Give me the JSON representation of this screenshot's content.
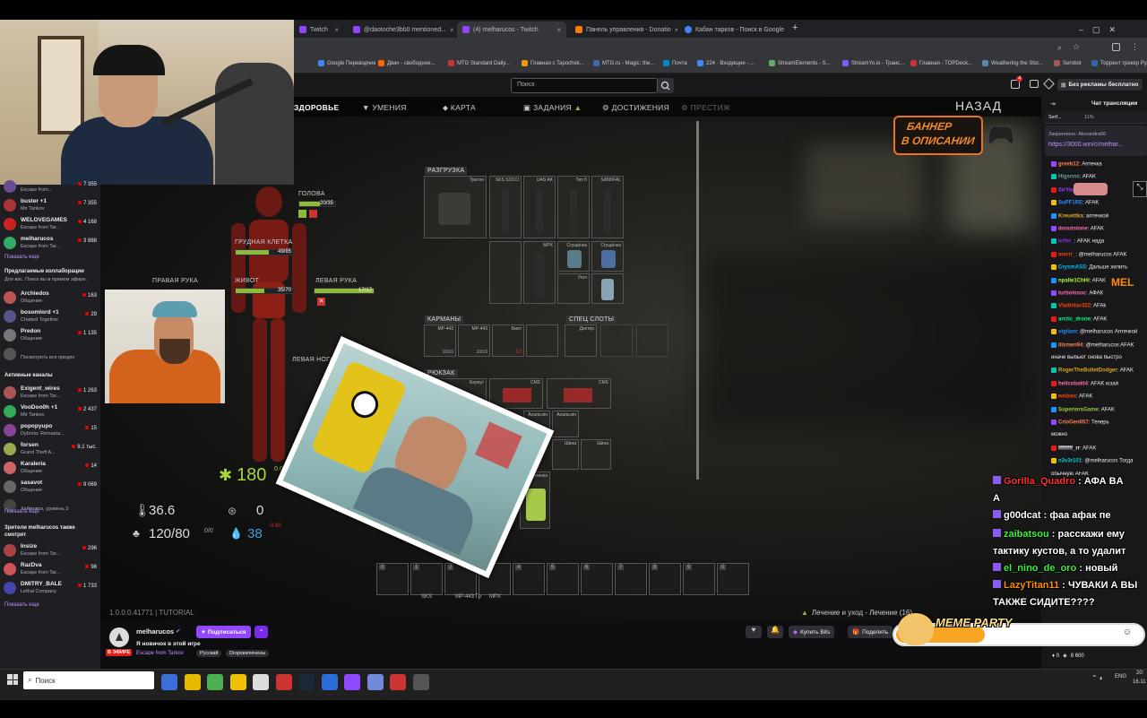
{
  "browser": {
    "tabs": [
      {
        "title": "Twitch",
        "color": "#9146ff"
      },
      {
        "title": "@daotoche3bb0 mentioned...",
        "color": "#9146ff"
      },
      {
        "title": "(4) melharucos - Twitch",
        "color": "#9146ff"
      },
      {
        "title": "Панель управления - Donatio",
        "color": "#f57c00"
      },
      {
        "title": "Кабан тарков - Поиск в Google",
        "color": "#4285f4"
      }
    ],
    "new_tab": "+",
    "bookmarks": [
      "Google Переводчик",
      "Двач - свободное...",
      "MTG Standard Daily...",
      "Главная с Tapochek...",
      "MTG.ru - Magic: the...",
      "Почта",
      "224 · Входящие - ...",
      "StreamElements - S...",
      "StreamYo.io - Транс...",
      "Главная - TOPDeck...",
      "Weathering the Stor...",
      "Servbot",
      "Торрент трекер Ру..."
    ]
  },
  "twitch": {
    "search_placeholder": "Поиск",
    "notif_count": "4",
    "ad_free": "Без рекламы бесплатно",
    "chat_title": "Чат трансляции"
  },
  "sidebar": {
    "channels_top": [
      {
        "name": "",
        "game": "Escape from...",
        "viewers": "7 355",
        "color": "#6a4c93"
      },
      {
        "name": "buster +1",
        "game": "Mir Tankov",
        "viewers": "7 355",
        "color": "#a33"
      },
      {
        "name": "WELOVEGAMES",
        "game": "Escape from Tar...",
        "viewers": "4 168",
        "color": "#c22"
      },
      {
        "name": "melharucos",
        "game": "Escape from Tar...",
        "viewers": "3 888",
        "color": "#3a6"
      }
    ],
    "show_more_1": "Показать еще",
    "collab_title": "Предлагаемые коллаборации",
    "collab_sub": "Для вас. Поиск вы в прямом эфире.",
    "collabs": [
      {
        "name": "Archiedos",
        "game": "Общение",
        "viewers": "163",
        "color": "#b55"
      },
      {
        "name": "bosomlord +1",
        "game": "Chatted Together",
        "viewers": "29",
        "color": "#558"
      },
      {
        "name": "Predon",
        "game": "Общение",
        "viewers": "1 135",
        "color": "#777"
      },
      {
        "name": "",
        "game": "Посмотреть вся предложения",
        "viewers": "",
        "color": "#555"
      }
    ],
    "active_title": "Активные каналы",
    "active": [
      {
        "name": "Exigent_wires",
        "game": "Escape from Tar...",
        "viewers": "1 263",
        "color": "#a55"
      },
      {
        "name": "VooDoo0h +1",
        "game": "Mir Tankov",
        "viewers": "2 437",
        "color": "#3a5"
      },
      {
        "name": "popopyupo",
        "game": "Dyboria: Remasta...",
        "viewers": "15",
        "color": "#849"
      },
      {
        "name": "forsen",
        "game": "Grand Theft A...",
        "viewers": "9,1 тыс.",
        "color": "#9a5"
      },
      {
        "name": "Karaleria",
        "game": "Общение",
        "viewers": "14",
        "color": "#c66"
      },
      {
        "name": "sasavot",
        "game": "Общение",
        "viewers": "9 069",
        "color": "#666"
      },
      {
        "name": "",
        "game": "Хаймовоз, уровень 3",
        "viewers": "",
        "color": "#444"
      }
    ],
    "show_more_2": "Показать еще",
    "viewers_title": "Зрители melharucos также смотрят",
    "also": [
      {
        "name": "Insize",
        "game": "Escape from Tar...",
        "viewers": "296",
        "color": "#a44"
      },
      {
        "name": "RazDva",
        "game": "Escape from Tar...",
        "viewers": "98",
        "color": "#c55"
      },
      {
        "name": "DMITRY_BALE",
        "game": "Lethal Company",
        "viewers": "1 733",
        "color": "#44a"
      }
    ],
    "show_more_3": "Показать еще"
  },
  "game": {
    "nav": [
      {
        "label": "ЗДОРОВЬЕ",
        "active": true
      },
      {
        "label": "УМЕНИЯ",
        "active": false
      },
      {
        "label": "КАРТА",
        "active": false
      },
      {
        "label": "ЗАДАНИЯ",
        "active": false
      },
      {
        "label": "ДОСТИЖЕНИЯ",
        "active": false
      },
      {
        "label": "ПРЕСТИЖ",
        "active": false
      }
    ],
    "back": "НАЗАД",
    "banner_line1": "БАННЕР",
    "banner_line2": "В ОПИСАНИИ",
    "body": {
      "head": {
        "label": "ГОЛОВА",
        "value": "20/35",
        "fill": 0.57
      },
      "thorax": {
        "label": "ГРУДНАЯ КЛЕТКА",
        "value": "49/85",
        "fill": 0.58
      },
      "right_arm": {
        "label": "ПРАВАЯ РУКА",
        "value": "",
        "fill": 0
      },
      "left_arm": {
        "label": "ЛЕВАЯ РУКА",
        "value": "17/17",
        "fill": 1
      },
      "stomach": {
        "label": "ЖИВОТ",
        "value": "35/70",
        "fill": 0.5
      },
      "left_leg": {
        "label": "ЛЕВАЯ НОГА",
        "value": "",
        "fill": 0
      }
    },
    "health_total": "180",
    "health_small": "0.00",
    "temperature": "36.6",
    "weight": "120/80",
    "weight_extra": "0/0",
    "energy": "0",
    "hydration": "38",
    "hydration_extra": "-0.80",
    "sections": {
      "rig": "РАЗГРУЗКА",
      "pockets": "КАРМАНЫ",
      "special": "СПЕЦ СЛОТЫ",
      "backpack": "РЮКЗАК"
    },
    "rig_items": [
      "Тритон",
      "SKS SOCO",
      "UAS AK",
      "Тип 5",
      "SA58/FAL",
      "MPX",
      "Сгущёнка",
      "Угол",
      "CMS",
      "Бинт"
    ],
    "pocket_items": [
      "MP-443",
      "MP-443",
      "Бинт"
    ],
    "pocket_counts": [
      "10/10",
      "10/10",
      "1/2"
    ],
    "special_items": [
      "Дихтер"
    ],
    "backpack_items": [
      "Беркут",
      "CMS",
      "CMS",
      "Анальгин",
      "Анальгин",
      "Шина",
      "Шина",
      "Зеленка"
    ],
    "quickbar": [
      "0",
      "1",
      "2",
      "3",
      "4",
      "5",
      "6",
      "7",
      "8",
      "9",
      "0"
    ],
    "quick_labels": [
      "SKS",
      "MP-443 Гр",
      "MPX"
    ],
    "version": "1.0.0.0.41771 | TUTORIAL",
    "status_line": "Лечение и уход - Лечение (16)"
  },
  "stream": {
    "channel": "melharucos",
    "follow": "Подписаться",
    "title": "Я новичок в этой игре",
    "live": "В ЭФИРЕ",
    "game": "Escape from Tarkov",
    "tags": [
      "Русский",
      "Dropsвключены"
    ],
    "buy_bits": "Купить Bits",
    "share": "Поделить"
  },
  "chat": {
    "pinned_by": "Закреплено: Alexandra66",
    "pinned_link": "https://3000.win/c/melhar...",
    "top_user": "Serf...",
    "top_count": "11%",
    "messages": [
      {
        "user": "greeb12",
        "text": "Аптечка",
        "color": "#ff7f50"
      },
      {
        "user": "Higsnns",
        "text": "AFAK",
        "color": "#5f9ea0"
      },
      {
        "user": "SirYog",
        "text": "",
        "color": "#9146ff"
      },
      {
        "user": "SuPF1RE",
        "text": "AFAK",
        "color": "#1e90ff"
      },
      {
        "user": "Kreuettka",
        "text": "аптечкой",
        "color": "#daa520"
      },
      {
        "user": "donutstone",
        "text": "AFAK",
        "color": "#ff69b4"
      },
      {
        "user": "leifer_",
        "text": "AFAK нада",
        "color": "#8a2be2"
      },
      {
        "user": "morrr_",
        "text": "@melharucos AFAK",
        "color": "#ff4500"
      },
      {
        "user": "CrysmASS",
        "text": "Дальше хилить",
        "color": "#00bfff"
      },
      {
        "user": "npalle1ChHi",
        "text": "AFAK",
        "color": "#adff2f"
      },
      {
        "user": "turbolosoc",
        "text": "АФАК",
        "color": "#ff69b4"
      },
      {
        "user": "Vladislav322",
        "text": "AFAk",
        "color": "#ff4500"
      },
      {
        "user": "arctic_drone",
        "text": "AFAK",
        "color": "#00ff7f"
      },
      {
        "user": "vigilam",
        "text": "@melharucos Аптечкой",
        "color": "#1e90ff"
      },
      {
        "user": "lilsmen94",
        "text": "@melharucos AFAK",
        "color": "#ff7f50"
      },
      {
        "user": "",
        "text": "иначе выбьют снова быстро",
        "color": "#efeff1"
      },
      {
        "user": "RogerTheBulletDodger",
        "text": "AFAK",
        "color": "#daa520"
      },
      {
        "user": "hellcobakt4",
        "text": "AFAK юзай",
        "color": "#ff69b4"
      },
      {
        "user": "wolxas",
        "text": "AFAK",
        "color": "#ff4500"
      },
      {
        "user": "SuperiorsGame",
        "text": "AFAK",
        "color": "#9acd32"
      },
      {
        "user": "CrioGen657",
        "text": "Теперь",
        "color": "#ff7f50"
      },
      {
        "user": "",
        "text": "можно",
        "color": "#efeff1"
      },
      {
        "user": "ffffffff_rr",
        "text": "AFAK",
        "color": "#efeff1"
      },
      {
        "user": "n3v3r101",
        "text": "@melharucos Тогда",
        "color": "#00ced1"
      },
      {
        "user": "",
        "text": "обычную AFAK",
        "color": "#efeff1"
      }
    ],
    "overlay": [
      {
        "user": "Gorilla_Quadro",
        "text": "АФА BA",
        "color": "#ff2f2f"
      },
      {
        "user": "",
        "text": "A",
        "color": "#fff"
      },
      {
        "user": "g00dcat",
        "text": "фаа афак пе",
        "color": "#fff"
      },
      {
        "user": "zaibatsou",
        "text": "расскажи ему",
        "color": "#39f339"
      },
      {
        "user": "",
        "text": "тактику кустов, а то удалит",
        "color": "#fff"
      },
      {
        "user": "el_nino_de_oro",
        "text": "новый",
        "color": "#39f339"
      },
      {
        "user": "LazyTitan11",
        "text": "ЧУВАКИ А ВЫ",
        "color": "#ff8c00"
      },
      {
        "user": "",
        "text": "ТАКЖЕ СИДИТЕ????",
        "color": "#fff"
      }
    ],
    "meme_party_label": "MEME PARTY",
    "meme_party_value": "1084 / 3000",
    "meme_party_fill": 0.361,
    "bottom_points": "8 600",
    "small_mel": "MEL"
  },
  "taskbar": {
    "search": "Поиск",
    "lang": "ENG",
    "time": "20:",
    "date": "16.11"
  }
}
